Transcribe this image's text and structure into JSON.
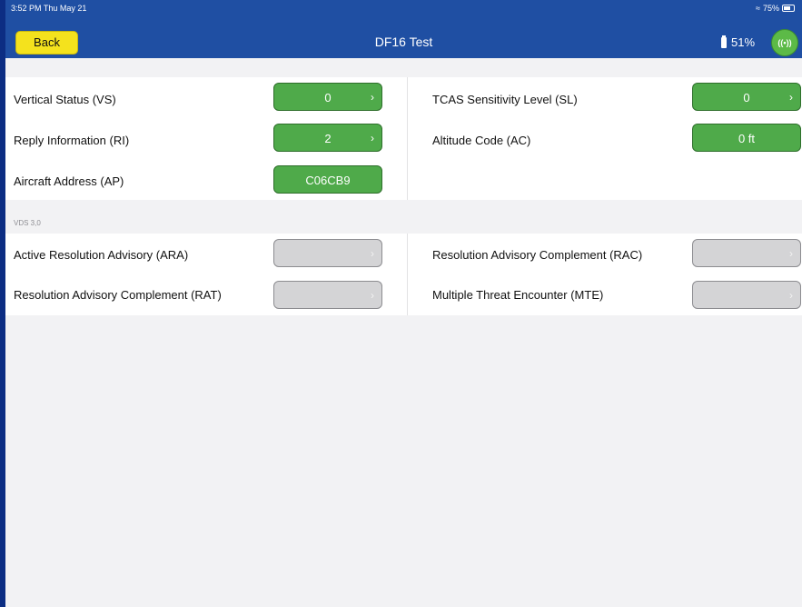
{
  "status_bar": {
    "time": "3:52 PM  Thu May 21",
    "battery": "75%"
  },
  "header": {
    "back_label": "Back",
    "title": "DF16 Test",
    "device_battery": "51%",
    "signal_glyph": "((•))"
  },
  "section1": {
    "left": [
      {
        "label": "Vertical Status (VS)",
        "value": "0",
        "chevron": true
      },
      {
        "label": "Reply Information (RI)",
        "value": "2",
        "chevron": true
      },
      {
        "label": "Aircraft Address (AP)",
        "value": "C06CB9",
        "chevron": false
      }
    ],
    "right": [
      {
        "label": "TCAS Sensitivity Level (SL)",
        "value": "0",
        "chevron": true
      },
      {
        "label": "Altitude Code (AC)",
        "value": "0 ft",
        "chevron": false
      }
    ]
  },
  "section2": {
    "header": "VDS 3,0",
    "left": [
      {
        "label": "Active Resolution Advisory (ARA)",
        "value": ""
      },
      {
        "label": "Resolution Advisory Complement (RAT)",
        "value": ""
      }
    ],
    "right": [
      {
        "label": "Resolution Advisory Complement (RAC)",
        "value": ""
      },
      {
        "label": "Multiple Threat Encounter (MTE)",
        "value": ""
      }
    ]
  },
  "colors": {
    "header_bg": "#1f4fa3",
    "back_button": "#f4e21d",
    "value_green": "#4faa4a",
    "value_gray": "#d4d4d6"
  }
}
